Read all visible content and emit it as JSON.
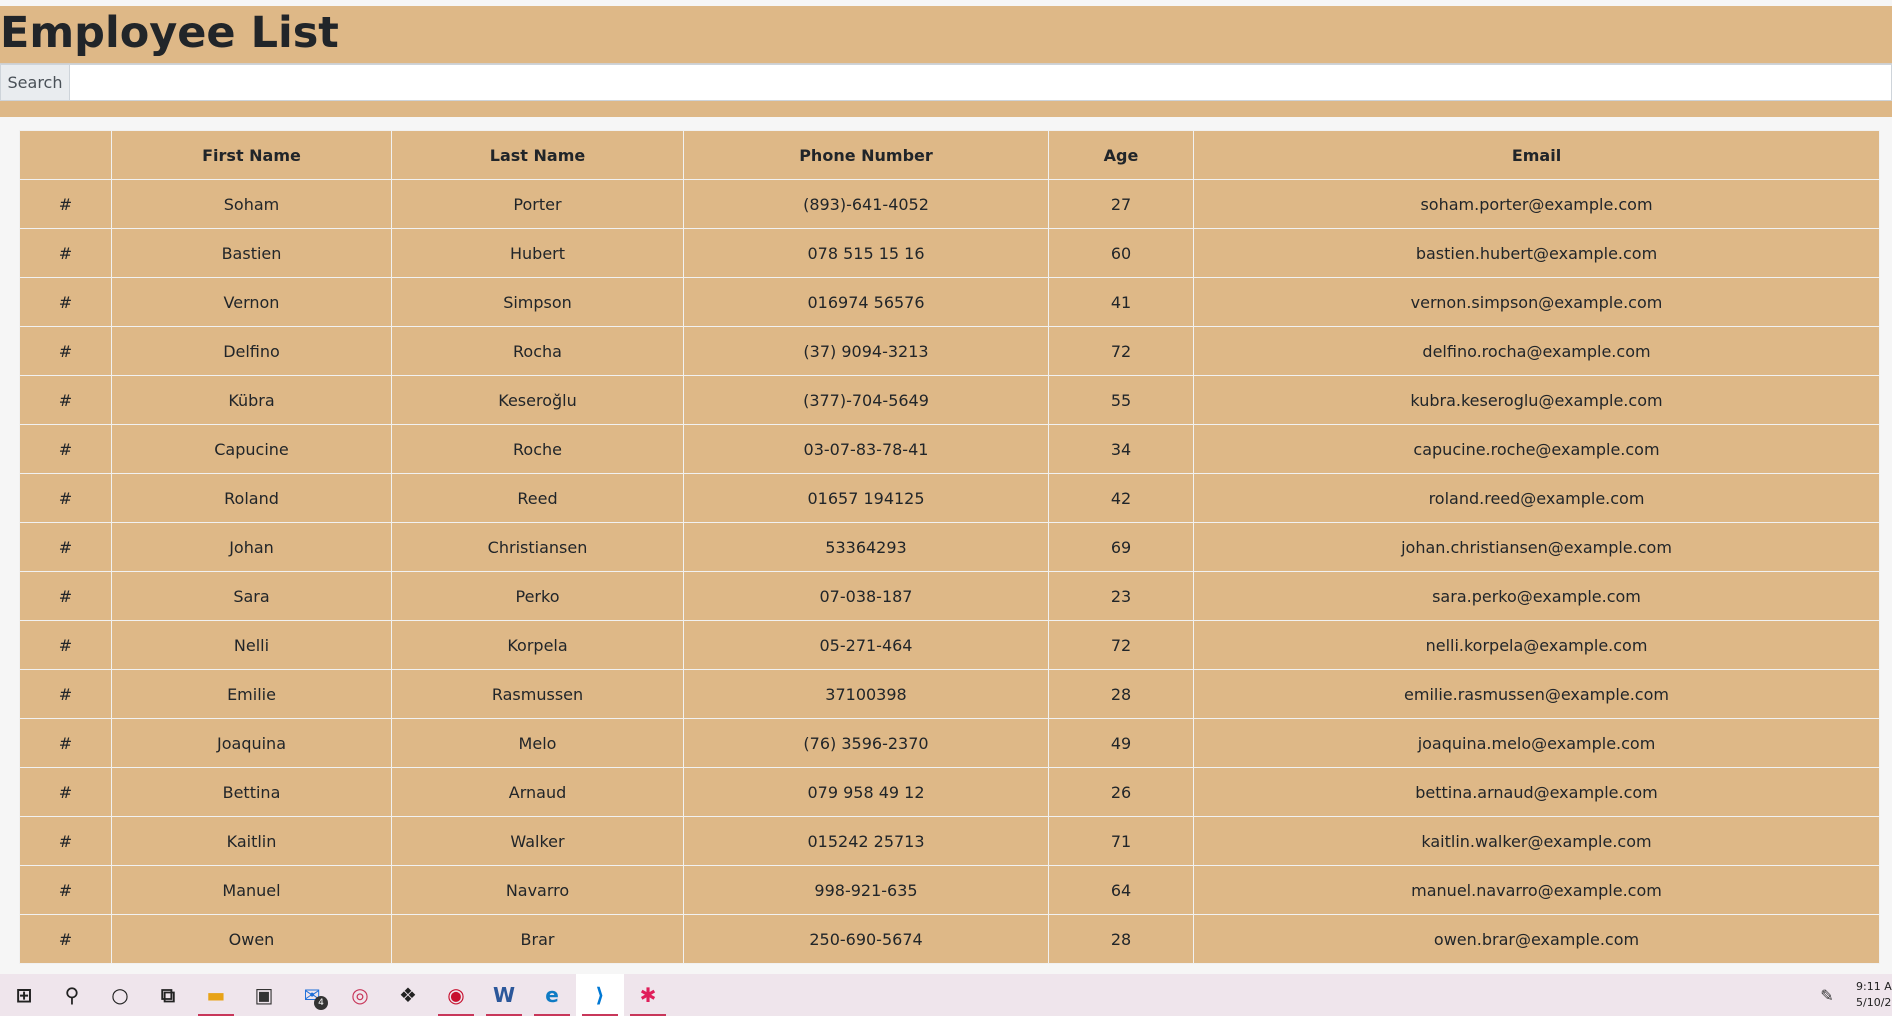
{
  "page": {
    "title": "Employee List"
  },
  "search": {
    "label": "Search",
    "value": "",
    "placeholder": ""
  },
  "table": {
    "headers": [
      "",
      "First Name",
      "Last Name",
      "Phone Number",
      "Age",
      "Email"
    ],
    "rows": [
      [
        "#",
        "Soham",
        "Porter",
        "(893)-641-4052",
        "27",
        "soham.porter@example.com"
      ],
      [
        "#",
        "Bastien",
        "Hubert",
        "078 515 15 16",
        "60",
        "bastien.hubert@example.com"
      ],
      [
        "#",
        "Vernon",
        "Simpson",
        "016974 56576",
        "41",
        "vernon.simpson@example.com"
      ],
      [
        "#",
        "Delfino",
        "Rocha",
        "(37) 9094-3213",
        "72",
        "delfino.rocha@example.com"
      ],
      [
        "#",
        "Kübra",
        "Keseroğlu",
        "(377)-704-5649",
        "55",
        "kubra.keseroglu@example.com"
      ],
      [
        "#",
        "Capucine",
        "Roche",
        "03-07-83-78-41",
        "34",
        "capucine.roche@example.com"
      ],
      [
        "#",
        "Roland",
        "Reed",
        "01657 194125",
        "42",
        "roland.reed@example.com"
      ],
      [
        "#",
        "Johan",
        "Christiansen",
        "53364293",
        "69",
        "johan.christiansen@example.com"
      ],
      [
        "#",
        "Sara",
        "Perko",
        "07-038-187",
        "23",
        "sara.perko@example.com"
      ],
      [
        "#",
        "Nelli",
        "Korpela",
        "05-271-464",
        "72",
        "nelli.korpela@example.com"
      ],
      [
        "#",
        "Emilie",
        "Rasmussen",
        "37100398",
        "28",
        "emilie.rasmussen@example.com"
      ],
      [
        "#",
        "Joaquina",
        "Melo",
        "(76) 3596-2370",
        "49",
        "joaquina.melo@example.com"
      ],
      [
        "#",
        "Bettina",
        "Arnaud",
        "079 958 49 12",
        "26",
        "bettina.arnaud@example.com"
      ],
      [
        "#",
        "Kaitlin",
        "Walker",
        "015242 25713",
        "71",
        "kaitlin.walker@example.com"
      ],
      [
        "#",
        "Manuel",
        "Navarro",
        "998-921-635",
        "64",
        "manuel.navarro@example.com"
      ],
      [
        "#",
        "Owen",
        "Brar",
        "250-690-5674",
        "28",
        "owen.brar@example.com"
      ]
    ]
  },
  "taskbar": {
    "items": [
      {
        "name": "windows-start-icon",
        "glyph": "⊞",
        "color": "#222222"
      },
      {
        "name": "search-icon",
        "glyph": "⚲",
        "color": "#222222"
      },
      {
        "name": "cortana-icon",
        "glyph": "○",
        "color": "#222222"
      },
      {
        "name": "task-view-icon",
        "glyph": "⧉",
        "color": "#222222"
      },
      {
        "name": "file-explorer-icon",
        "glyph": "▬",
        "color": "#e8a317",
        "active": true
      },
      {
        "name": "store-icon",
        "glyph": "▣",
        "color": "#333333"
      },
      {
        "name": "mail-icon",
        "glyph": "✉",
        "color": "#1e6fd9",
        "badge": "4"
      },
      {
        "name": "app-red-icon",
        "glyph": "◎",
        "color": "#c8375a"
      },
      {
        "name": "dropbox-icon",
        "glyph": "❖",
        "color": "#222222"
      },
      {
        "name": "app-acrobat-icon",
        "glyph": "◉",
        "color": "#c8102e",
        "active": true
      },
      {
        "name": "word-icon",
        "glyph": "W",
        "color": "#2b579a",
        "active": true
      },
      {
        "name": "edge-icon",
        "glyph": "e",
        "color": "#0f7bc4",
        "active": true
      },
      {
        "name": "vscode-icon",
        "glyph": "⟩",
        "color": "#0078d4",
        "active": true,
        "current": true
      },
      {
        "name": "slack-icon",
        "glyph": "✱",
        "color": "#e01e5a",
        "active": true
      }
    ],
    "clock": {
      "time": "9:11 A",
      "date": "5/10/2"
    }
  }
}
